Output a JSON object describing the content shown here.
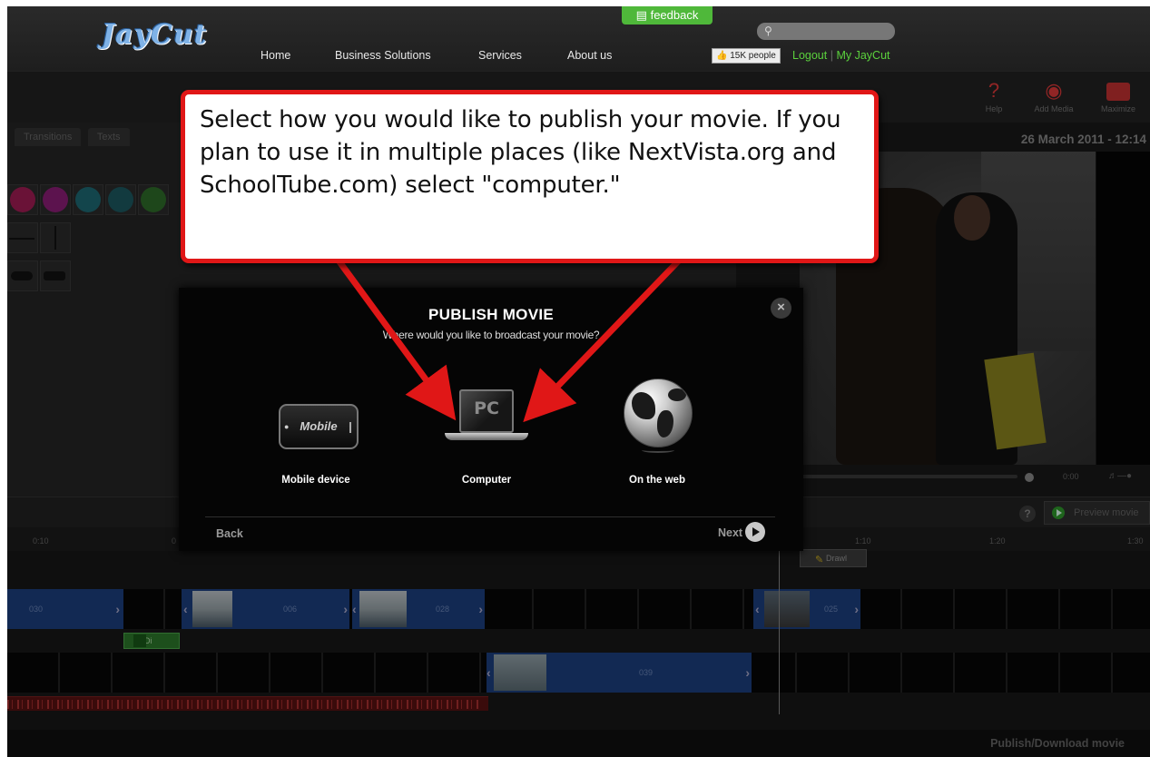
{
  "brand": {
    "logo_text": "JayCut",
    "accent": "#4fb83a",
    "callout_color": "#e01717"
  },
  "header": {
    "feedback_label": "feedback",
    "nav": [
      "Home",
      "Business Solutions",
      "Services",
      "About us"
    ],
    "search_placeholder": "",
    "likes_label": "15K people",
    "logout_label": "Logout",
    "myjaycut_label": "My JayCut"
  },
  "toolbar": {
    "help_label": "Help",
    "add_media_label": "Add Media",
    "maximize_label": "Maximize"
  },
  "editor": {
    "tabs": [
      "Transitions",
      "Texts"
    ],
    "date_label": "26 March 2011 - 12:14",
    "time_readout": "0:00",
    "help_symbol": "?",
    "preview_label": "Preview movie",
    "timeline_marks": [
      "0:10",
      "0",
      "1:10",
      "1:20",
      "1:30"
    ],
    "drawl_label": "Drawl",
    "clip_labels": [
      "030",
      "006",
      "028",
      "025",
      "039"
    ],
    "green_clip_label": "Di",
    "publish_download_label": "Publish/Download movie"
  },
  "modal": {
    "title": "PUBLISH MOVIE",
    "subtitle": "Where would you like to broadcast your movie?",
    "close_symbol": "×",
    "options": [
      {
        "label": "Mobile device",
        "icon_text": "Mobile",
        "icon": "mobile-phone-icon"
      },
      {
        "label": "Computer",
        "icon_text": "PC",
        "icon": "laptop-icon"
      },
      {
        "label": "On the web",
        "icon": "globe-icon"
      }
    ],
    "back_label": "Back",
    "next_label": "Next"
  },
  "callout": {
    "text": "Select how you would like to publish your movie. If you plan to use it in multiple places (like NextVista.org and SchoolTube.com) select \"computer.\""
  }
}
